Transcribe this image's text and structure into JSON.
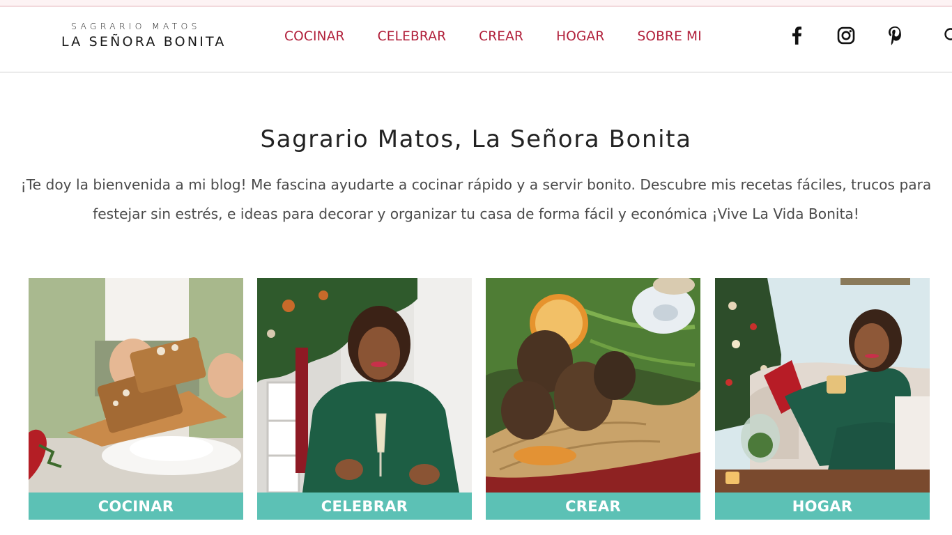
{
  "logo": {
    "top_line": "SAGRARIO MATOS",
    "main_line": "LA SEÑORA BONITA"
  },
  "nav": {
    "items": [
      {
        "label": "COCINAR"
      },
      {
        "label": "CELEBRAR"
      },
      {
        "label": "CREAR"
      },
      {
        "label": "HOGAR"
      },
      {
        "label": "SOBRE MI"
      }
    ]
  },
  "social": {
    "icons": [
      "facebook-icon",
      "instagram-icon",
      "pinterest-icon",
      "search-icon"
    ]
  },
  "hero": {
    "title": "Sagrario Matos, La Señora Bonita",
    "intro": "¡Te doy la bienvenida a mi blog! Me fascina ayudarte a cocinar rápido y a servir bonito. Descubre mis recetas fáciles, trucos para festejar sin estrés, e ideas para decorar y organizar tu casa de forma fácil y económica ¡Vive La Vida Bonita!"
  },
  "cards": [
    {
      "label": "COCINAR"
    },
    {
      "label": "CELEBRAR"
    },
    {
      "label": "CREAR"
    },
    {
      "label": "HOGAR"
    }
  ],
  "colors": {
    "nav_text": "#b01d38",
    "card_label_bg": "#5cc1b5",
    "title_text": "#222222",
    "body_text": "#4a4a4a"
  }
}
